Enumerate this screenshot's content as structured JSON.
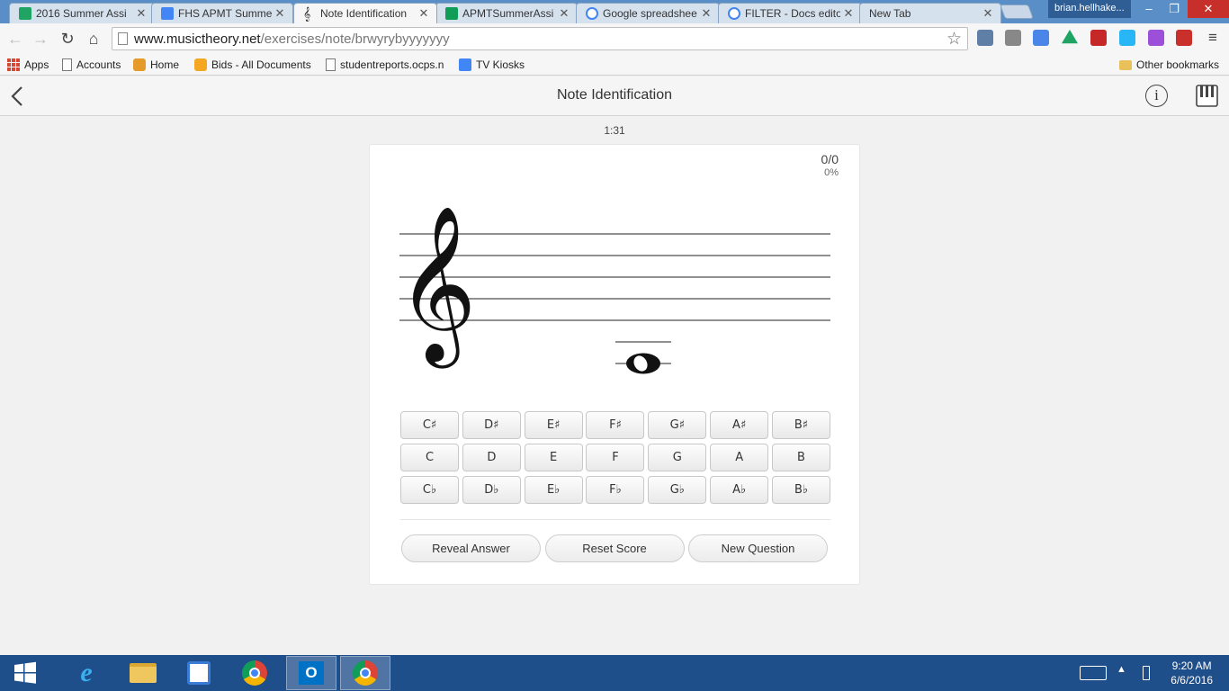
{
  "browser": {
    "tabs": [
      {
        "title": "2016 Summer Assi",
        "favicon_color": "#1fa463",
        "active": false
      },
      {
        "title": "FHS APMT Summe",
        "favicon_color": "#4285f4",
        "active": false
      },
      {
        "title": "Note Identification",
        "favicon_color": "#222222",
        "active": true
      },
      {
        "title": "APMTSummerAssi",
        "favicon_color": "#0f9d58",
        "active": false
      },
      {
        "title": "Google spreadshee",
        "favicon_color": "#4285f4",
        "active": false
      },
      {
        "title": "FILTER - Docs edito",
        "favicon_color": "#4285f4",
        "active": false
      },
      {
        "title": "New Tab",
        "favicon_color": "",
        "active": false
      }
    ],
    "profile_name": "brian.hellhake...",
    "url_host": "www.musictheory.net",
    "url_path": "/exercises/note/brwyrybyyyyyyy",
    "bookmarks": [
      "Apps",
      "Accounts",
      "Home",
      "Bids - All Documents",
      "studentreports.ocps.n",
      "TV Kiosks"
    ],
    "other_bookmarks": "Other bookmarks"
  },
  "page": {
    "title": "Note Identification",
    "timer": "1:31",
    "score": "0/0",
    "score_percent": "0%",
    "note_buttons": {
      "sharps": [
        "C♯",
        "D♯",
        "E♯",
        "F♯",
        "G♯",
        "A♯",
        "B♯"
      ],
      "naturals": [
        "C",
        "D",
        "E",
        "F",
        "G",
        "A",
        "B"
      ],
      "flats": [
        "C♭",
        "D♭",
        "E♭",
        "F♭",
        "G♭",
        "A♭",
        "B♭"
      ]
    },
    "actions": {
      "reveal": "Reveal Answer",
      "reset": "Reset Score",
      "new_question": "New Question"
    },
    "staff": {
      "clef": "treble",
      "note": "whole note on 2nd ledger line below staff"
    }
  },
  "taskbar": {
    "time": "9:20 AM",
    "date": "6/6/2016"
  }
}
